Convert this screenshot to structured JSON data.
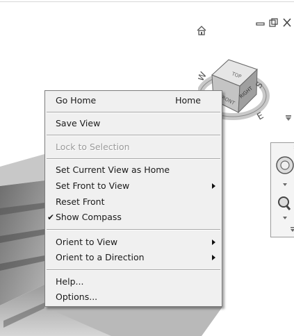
{
  "window": {
    "minimize_icon": "minimize-icon",
    "restore_icon": "restore-icon",
    "close_icon": "close-icon"
  },
  "viewcube": {
    "faces": {
      "top": "TOP",
      "right": "RIGHT",
      "front": "FRONT"
    },
    "compass": {
      "east": "E",
      "south": "S",
      "west": "W"
    },
    "home_icon": "home-icon"
  },
  "menu": {
    "go_home": {
      "label": "Go Home",
      "shortcut": "Home"
    },
    "save_view": {
      "label": "Save View"
    },
    "lock_to_selection": {
      "label": "Lock to Selection",
      "enabled": false
    },
    "set_current_view_as_home": {
      "label": "Set Current View as Home"
    },
    "set_front_to_view": {
      "label": "Set Front to View",
      "submenu": true
    },
    "reset_front": {
      "label": "Reset Front"
    },
    "show_compass": {
      "label": "Show Compass",
      "checked": true,
      "check": "✔"
    },
    "orient_to_view": {
      "label": "Orient to View",
      "submenu": true
    },
    "orient_to_direction": {
      "label": "Orient to a Direction",
      "submenu": true
    },
    "help": {
      "label": "Help..."
    },
    "options": {
      "label": "Options..."
    }
  },
  "colors": {
    "menu_bg": "#f0f0f0",
    "menu_border": "#7c7c7c",
    "disabled_text": "#9a9a9a",
    "floor_grey": "#8a8a8a"
  }
}
